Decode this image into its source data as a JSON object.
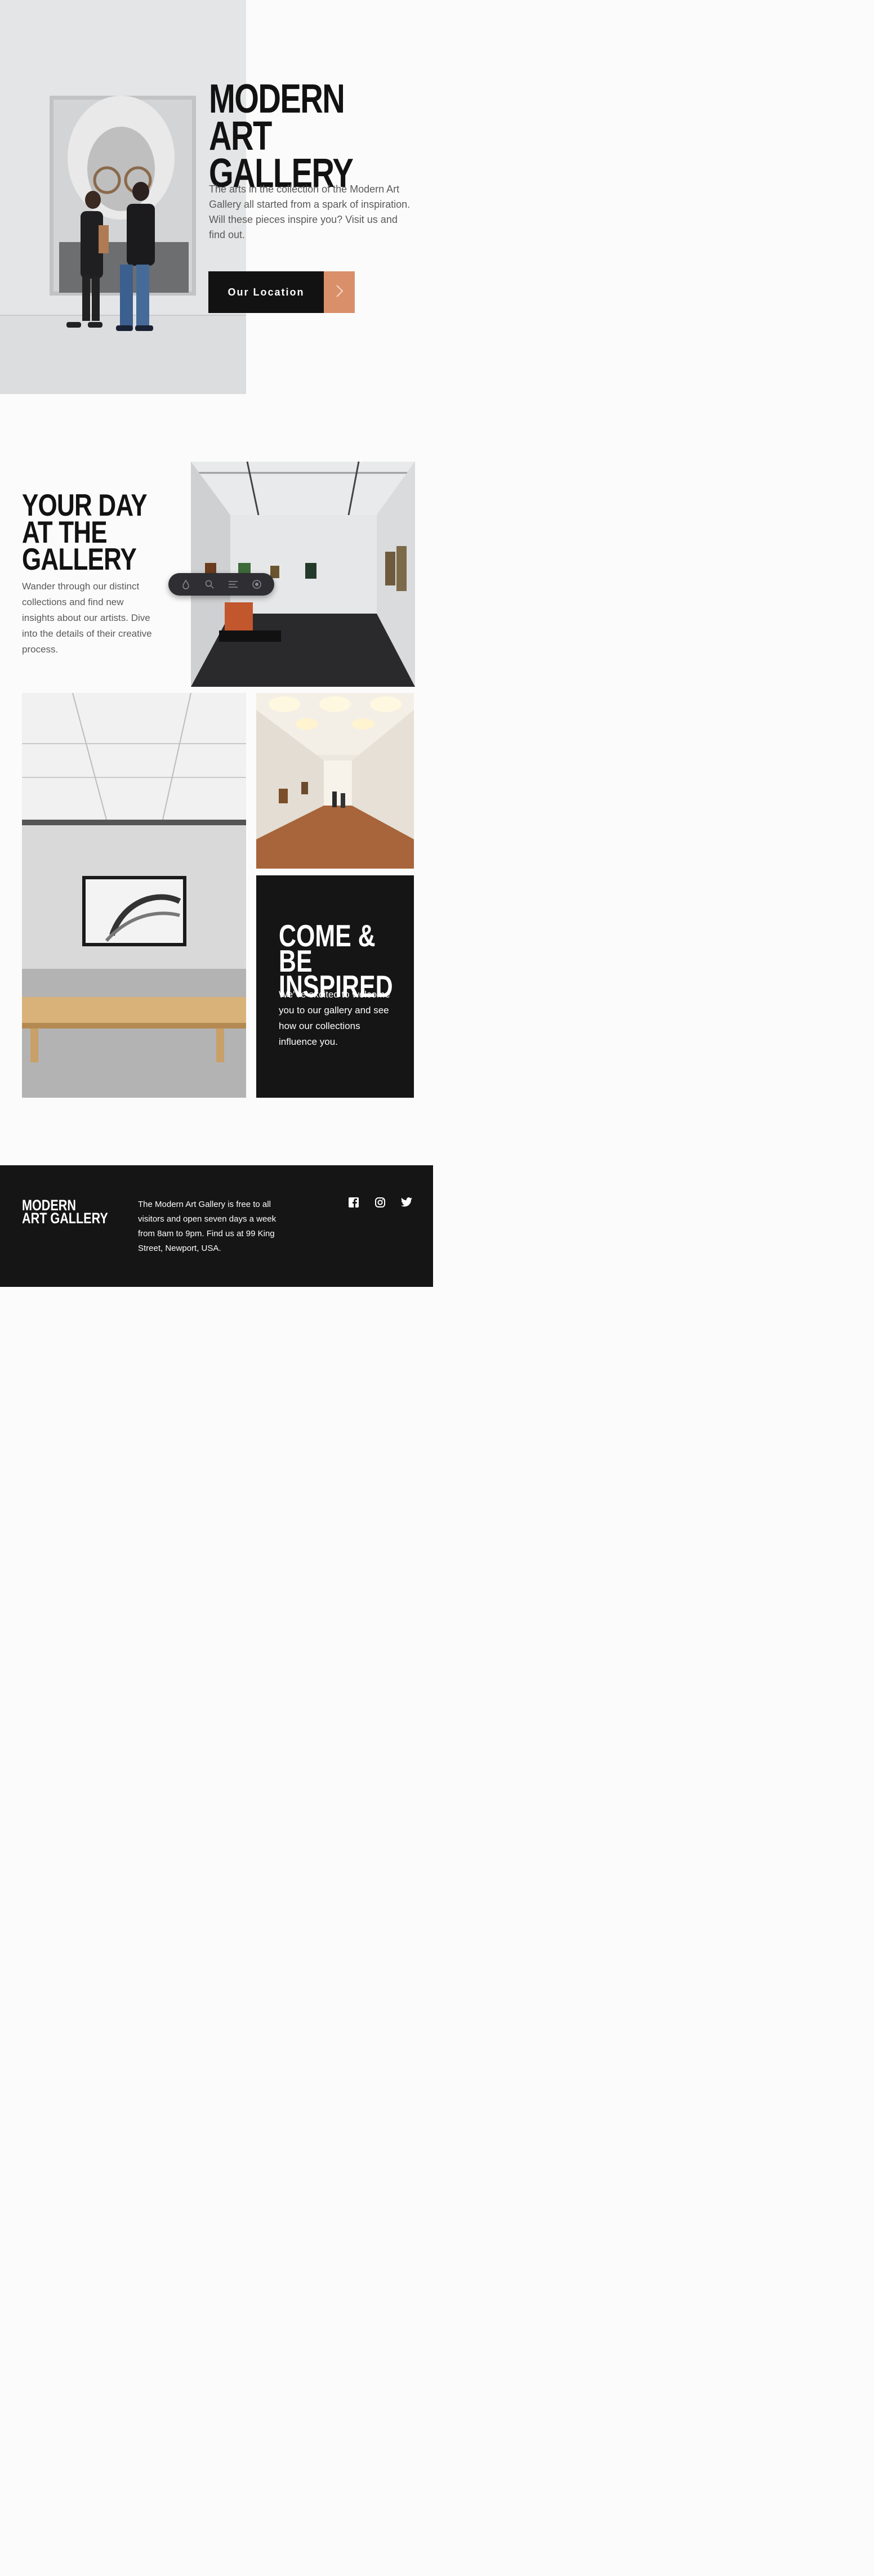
{
  "hero": {
    "title_line1": "MODERN",
    "title_line2": "ART GALLERY",
    "description": "The arts in the collection of the Modern Art Gallery all started from a spark of inspiration. Will these pieces inspire you? Visit us and find out.",
    "button_label": "Our Location",
    "accent_color": "#d9906a"
  },
  "day": {
    "title_line1": "YOUR DAY",
    "title_line2": "AT THE",
    "title_line3": "GALLERY",
    "description": "Wander through our distinct collections and find new insights about our artists. Dive into the details of their creative process."
  },
  "toolbar": {
    "icons": [
      "paint-drop-icon",
      "search-icon",
      "text-lines-icon",
      "settings-circle-icon"
    ]
  },
  "inspired": {
    "title_line1": "COME & BE",
    "title_line2": "INSPIRED",
    "description": "We' re excited to welcome you to our gallery and see how our collections influence you."
  },
  "footer": {
    "logo_line1": "MODERN",
    "logo_line2": "ART GALLERY",
    "description": "The Modern Art Gallery is free to all visitors and open seven days a week from 8am to 9pm. Find us at 99 King Street, Newport, USA.",
    "social": [
      "facebook-icon",
      "instagram-icon",
      "twitter-icon"
    ],
    "background_color": "#151515"
  }
}
